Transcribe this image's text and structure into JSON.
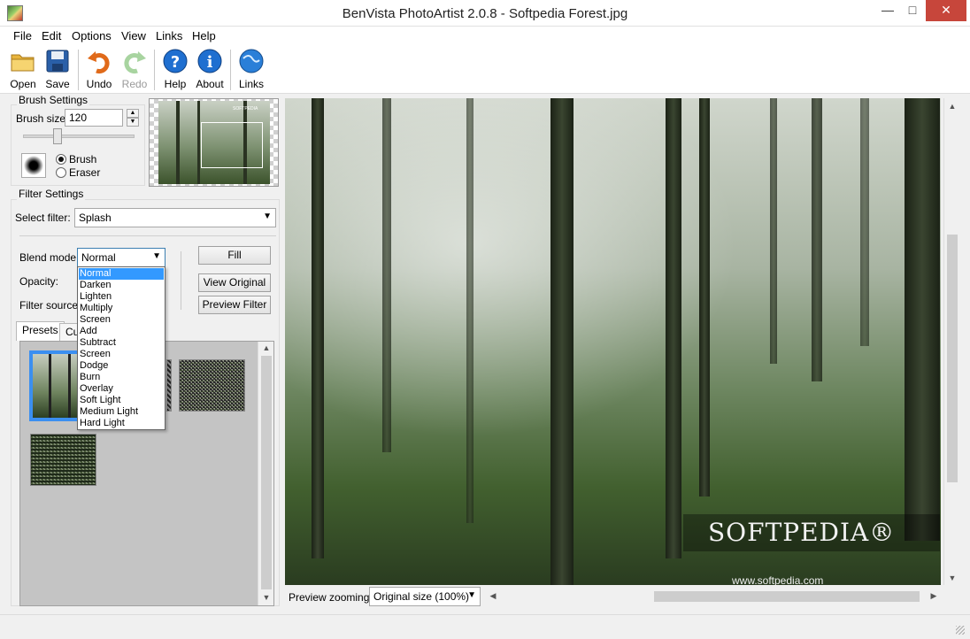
{
  "window": {
    "title": "BenVista PhotoArtist 2.0.8 - Softpedia Forest.jpg",
    "minimize": "—",
    "maximize": "□",
    "close": "✕"
  },
  "menu": [
    "File",
    "Edit",
    "Options",
    "View",
    "Links",
    "Help"
  ],
  "toolbar": {
    "open": "Open",
    "save": "Save",
    "undo": "Undo",
    "redo": "Redo",
    "help": "Help",
    "about": "About",
    "links": "Links"
  },
  "brush_settings": {
    "title": "Brush Settings",
    "size_label": "Brush size:",
    "size_value": "120",
    "mode_brush": "Brush",
    "mode_eraser": "Eraser"
  },
  "filter_settings": {
    "title": "Filter Settings",
    "select_label": "Select filter:",
    "selected_filter": "Splash",
    "blend_label": "Blend mode:",
    "blend_value": "Normal",
    "opacity_label": "Opacity:",
    "source_label": "Filter source:",
    "fill_button": "Fill",
    "view_original_button": "View Original",
    "preview_filter_button": "Preview Filter"
  },
  "tabs": {
    "presets": "Presets",
    "custom": "Cu"
  },
  "blend_modes": [
    "Normal",
    "Darken",
    "Lighten",
    "Multiply",
    "Screen",
    "Add",
    "Subtract",
    "Screen",
    "Dodge",
    "Burn",
    "Overlay",
    "Soft Light",
    "Medium Light",
    "Hard Light"
  ],
  "preview": {
    "watermark": "SOFTPEDIA®",
    "watermark_url": "www.softpedia.com",
    "zoom_label": "Preview zooming:",
    "zoom_value": "Original size (100%)"
  },
  "navigator_watermark": "SOFTPEDIA"
}
